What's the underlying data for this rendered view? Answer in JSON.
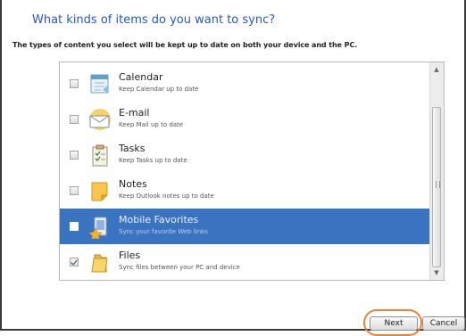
{
  "heading": "What kinds of items do you want to sync?",
  "subtitle": "The types of content you select will be kept up to date on both your device and the PC.",
  "items": [
    {
      "title": "Calendar",
      "desc": "Keep Calendar up to date",
      "checked": false,
      "selected": false,
      "icon": "calendar-icon"
    },
    {
      "title": "E-mail",
      "desc": "Keep Mail up to date",
      "checked": false,
      "selected": false,
      "icon": "envelope-icon"
    },
    {
      "title": "Tasks",
      "desc": "Keep Tasks up to date",
      "checked": false,
      "selected": false,
      "icon": "clipboard-icon"
    },
    {
      "title": "Notes",
      "desc": "Keep Outlook notes up to date",
      "checked": false,
      "selected": false,
      "icon": "note-icon"
    },
    {
      "title": "Mobile Favorites",
      "desc": "Sync your favorite Web links",
      "checked": false,
      "selected": true,
      "icon": "star-page-icon"
    },
    {
      "title": "Files",
      "desc": "Sync files between your PC and device",
      "checked": true,
      "selected": false,
      "icon": "folder-icon"
    }
  ],
  "buttons": {
    "next": "Next",
    "cancel": "Cancel"
  },
  "colors": {
    "heading": "#2a5aa8",
    "selection": "#3a74c0",
    "ring": "#e8833a"
  }
}
